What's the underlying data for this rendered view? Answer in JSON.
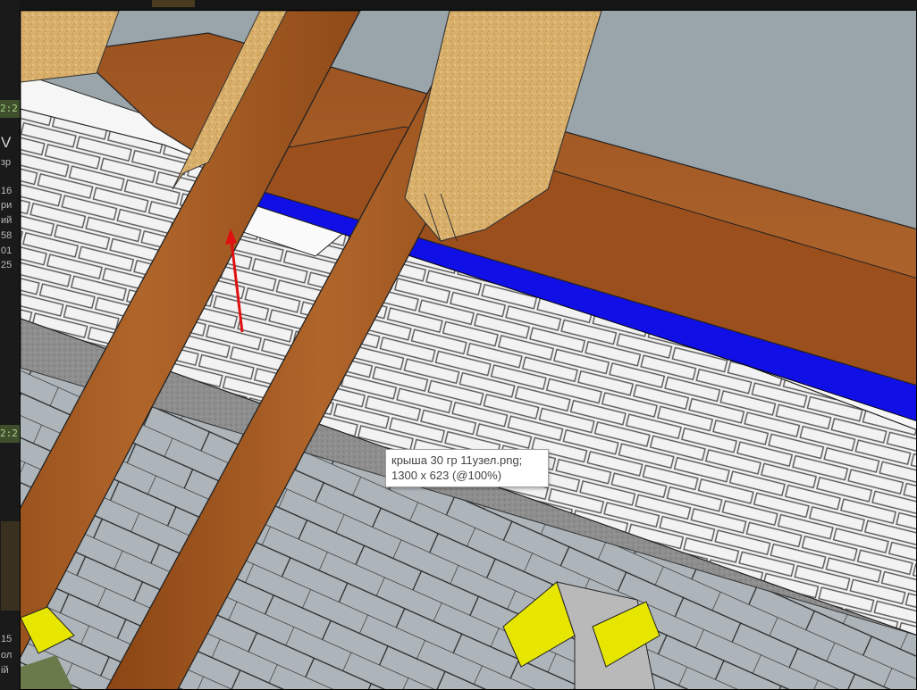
{
  "tooltip": {
    "filename": "крыша 30 гр 11узел.png;",
    "dimensions": "1300 x 623 (@100%)"
  },
  "background_window": {
    "fragments": [
      {
        "id": "f1",
        "text": "2:2"
      },
      {
        "id": "f2",
        "text": "V"
      },
      {
        "id": "f3",
        "text": "зр"
      },
      {
        "id": "f4",
        "text": "16"
      },
      {
        "id": "f5",
        "text": "ри"
      },
      {
        "id": "f6",
        "text": "ий"
      },
      {
        "id": "f7",
        "text": "58"
      },
      {
        "id": "f8",
        "text": "01"
      },
      {
        "id": "f9",
        "text": "25"
      },
      {
        "id": "f10",
        "text": "2:2"
      },
      {
        "id": "f11",
        "text": "15"
      },
      {
        "id": "f12",
        "text": "ол"
      },
      {
        "id": "f13",
        "text": "ій"
      }
    ]
  },
  "colors": {
    "sky": "#9aa4ab",
    "timber": "#a0561f",
    "osb": "#d8b06a",
    "insulation_band": "#1010e6",
    "brick": "#f0f0f0",
    "concrete": "#8c8c8c",
    "block": "#aab2b8",
    "accent_yellow": "#e6e600",
    "arrow": "#e01010"
  },
  "image": {
    "subject": "roof-node-render"
  }
}
